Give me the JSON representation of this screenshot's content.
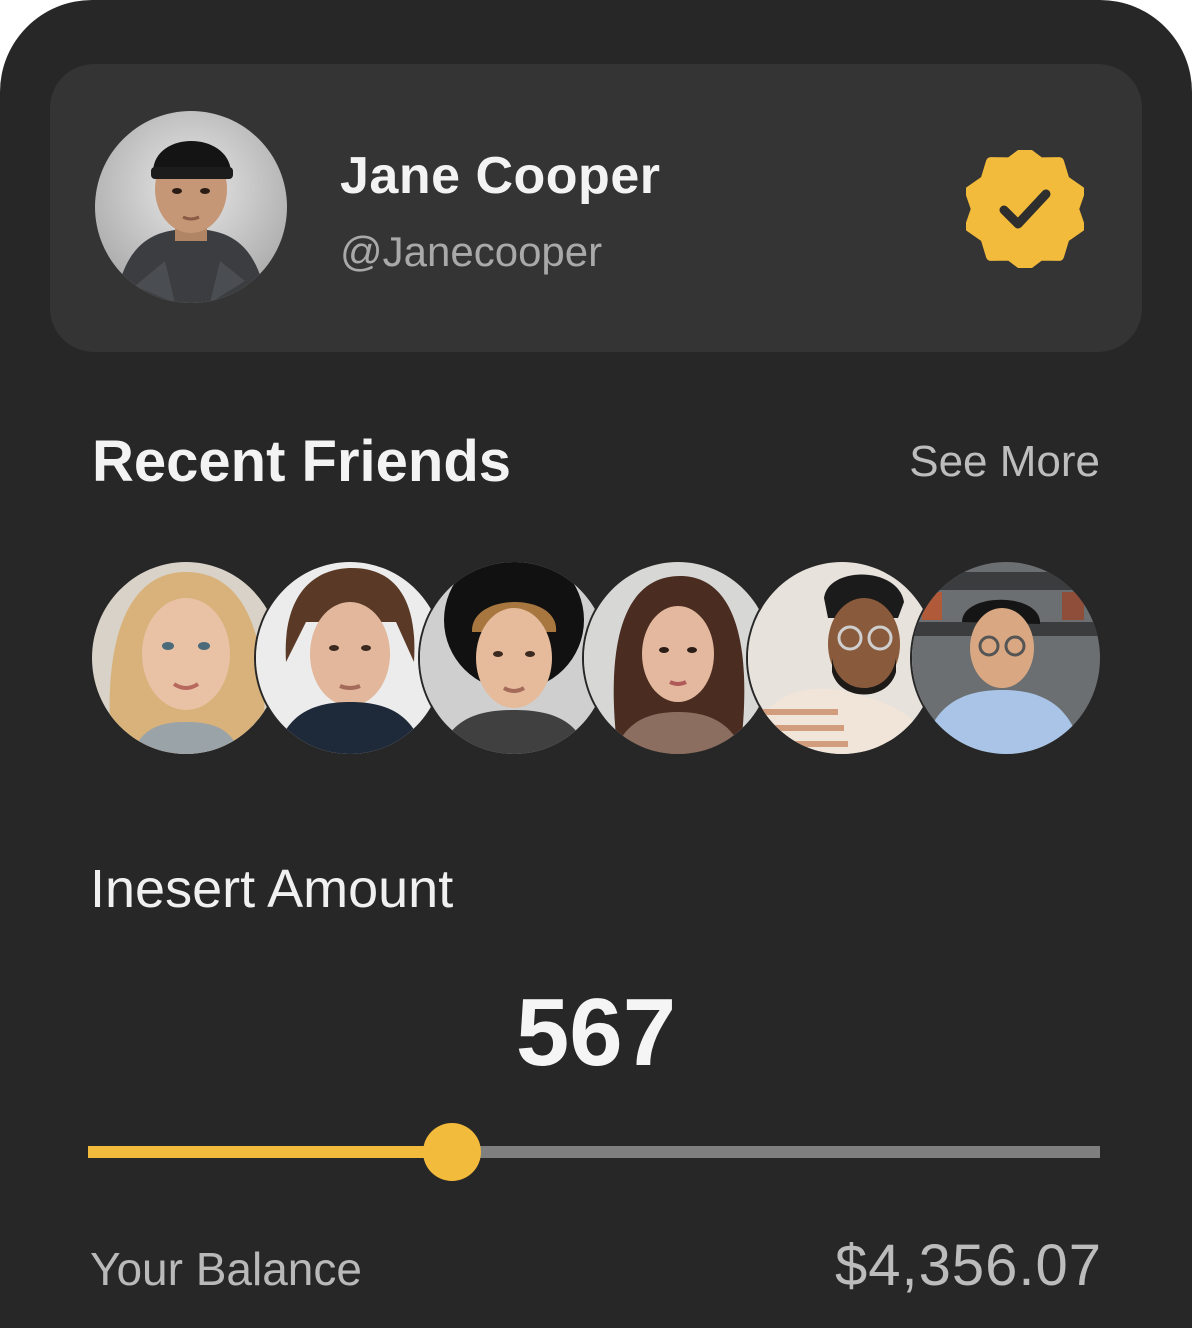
{
  "profile": {
    "name": "Jane Cooper",
    "handle": "@Janecooper",
    "verified": true,
    "badge_color": "#F3BB3B",
    "avatar_icon": "avatar-photo-man-beanie"
  },
  "friends_section": {
    "title": "Recent Friends",
    "see_more_label": "See More",
    "friends": [
      {
        "avatar_icon": "avatar-photo-blonde-woman"
      },
      {
        "avatar_icon": "avatar-photo-young-man"
      },
      {
        "avatar_icon": "avatar-photo-man-curly-hat"
      },
      {
        "avatar_icon": "avatar-photo-brunette-woman"
      },
      {
        "avatar_icon": "avatar-photo-man-glasses-beard"
      },
      {
        "avatar_icon": "avatar-photo-man-glasses"
      }
    ]
  },
  "amount": {
    "label": "Inesert Amount",
    "value": "567",
    "slider_fraction": 0.36,
    "accent_color": "#F3BB3B"
  },
  "balance": {
    "label": "Your Balance",
    "value": "$4,356.07"
  }
}
